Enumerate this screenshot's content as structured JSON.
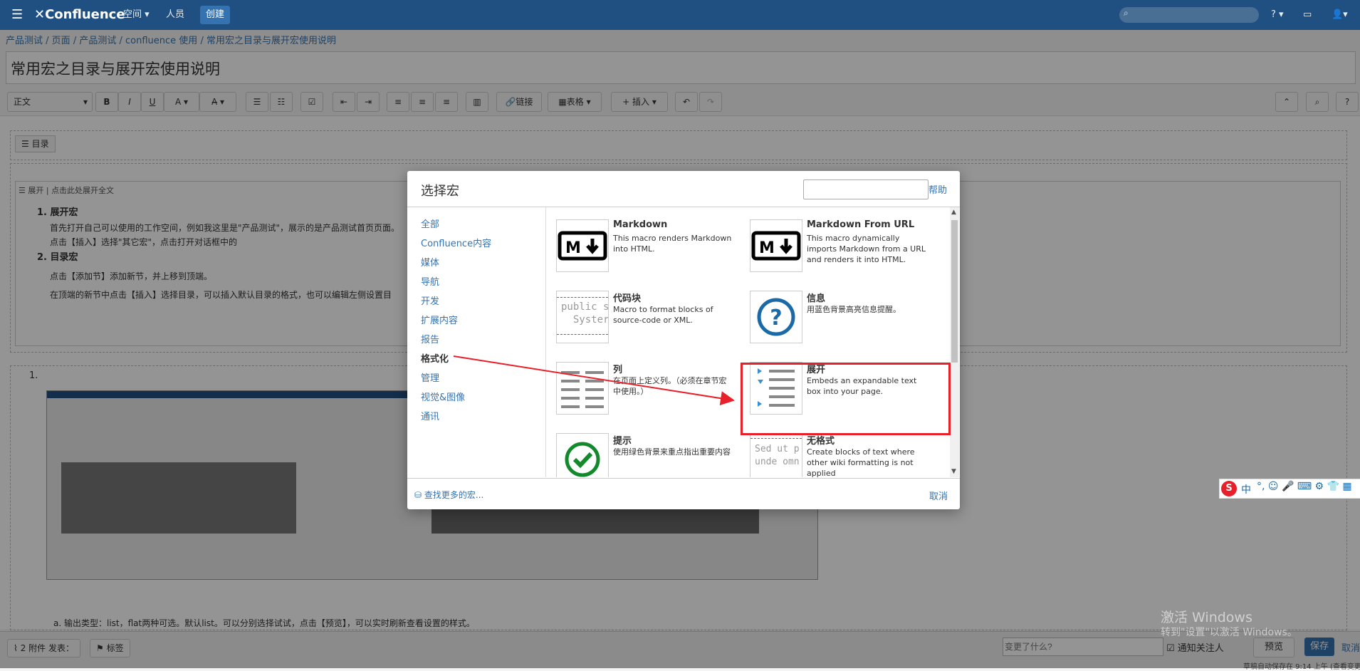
{
  "topnav": {
    "logo": "Confluence",
    "spaces": "空间",
    "people": "人员",
    "create": "创建"
  },
  "breadcrumb": [
    "产品测试",
    "页面",
    "产品测试",
    "confluence 使用",
    "常用宏之目录与展开宏使用说明"
  ],
  "page_title": "常用宏之目录与展开宏使用说明",
  "toolbar": {
    "paragraph": "正文",
    "link": "链接",
    "table": "表格",
    "insert": "插入"
  },
  "editor": {
    "toc_macro": "目录",
    "expand_title": "展开",
    "expand_hint": "点击此处展开全文",
    "h1": "1. 展开宏",
    "p1": "首先打开自己可以使用的工作空间，例如我这里是\"产品测试\"，展示的是产品测试首页页面。",
    "p2": "点击【插入】选择\"其它宏\"，点击打开对话框中的",
    "h2": "2. 目录宏",
    "p3": "点击【添加节】添加新节，并上移到顶端。",
    "p4": "在顶端的新节中点击【插入】选择目录，可以插入默认目录的格式，也可以编辑左侧设置目",
    "list_num": "1.",
    "note": "a. 输出类型：list，flat两种可选。默认list。可以分别选择试试，点击【预览】，可以实时刷新查看设置的样式。"
  },
  "dialog": {
    "title": "选择宏",
    "search_placeholder": "",
    "help": "帮助",
    "categories": [
      {
        "label": "全部",
        "active": false
      },
      {
        "label": "Confluence内容",
        "active": false
      },
      {
        "label": "媒体",
        "active": false
      },
      {
        "label": "导航",
        "active": false
      },
      {
        "label": "开发",
        "active": false
      },
      {
        "label": "扩展内容",
        "active": false
      },
      {
        "label": "报告",
        "active": false
      },
      {
        "label": "格式化",
        "active": true
      },
      {
        "label": "管理",
        "active": false
      },
      {
        "label": "视觉&图像",
        "active": false
      },
      {
        "label": "通讯",
        "active": false
      }
    ],
    "macros": [
      {
        "name": "Markdown",
        "desc": "This macro renders Markdown into HTML.",
        "icon": "markdown-icon"
      },
      {
        "name": "Markdown From URL",
        "desc": "This macro dynamically imports Markdown from a URL and renders it into HTML.",
        "icon": "markdown-icon"
      },
      {
        "name": "代码块",
        "desc": "Macro to format blocks of source-code or XML.",
        "icon": "code-block-icon",
        "icon_text": [
          "public s",
          "  Syster"
        ]
      },
      {
        "name": "信息",
        "desc": "用蓝色背景高亮信息提醒。",
        "icon": "info-question-icon"
      },
      {
        "name": "列",
        "desc": "在页面上定义列。（必须在章节宏中使用。）",
        "icon": "column-icon"
      },
      {
        "name": "展开",
        "desc": "Embeds an expandable text box into your page.",
        "icon": "expand-icon"
      },
      {
        "name": "提示",
        "desc": "使用绿色背景来重点指出重要内容",
        "icon": "tip-check-icon"
      },
      {
        "name": "无格式",
        "desc": "Create blocks of text where other wiki formatting is not applied",
        "icon": "noformat-icon",
        "icon_text": [
          "Sed ut p",
          "unde omn"
        ]
      }
    ],
    "find_more": "查找更多的宏...",
    "cancel": "取消"
  },
  "bottombar": {
    "attachments": "2 附件 发表：",
    "labels": "标签",
    "change_placeholder": "变更了什么?",
    "notify": "通知关注人",
    "preview": "预览",
    "save": "保存",
    "cancel": "取消",
    "autosave": "草稿自动保存在 9:14 上午 (查看变更"
  },
  "watermark": {
    "line1": "激活 Windows",
    "line2": "转到\"设置\"以激活 Windows。"
  },
  "ime": {
    "label": "中"
  },
  "colors": {
    "nav": "#205081",
    "link": "#3572b0",
    "annotation": "#e8202a",
    "save": "#3572b0"
  }
}
